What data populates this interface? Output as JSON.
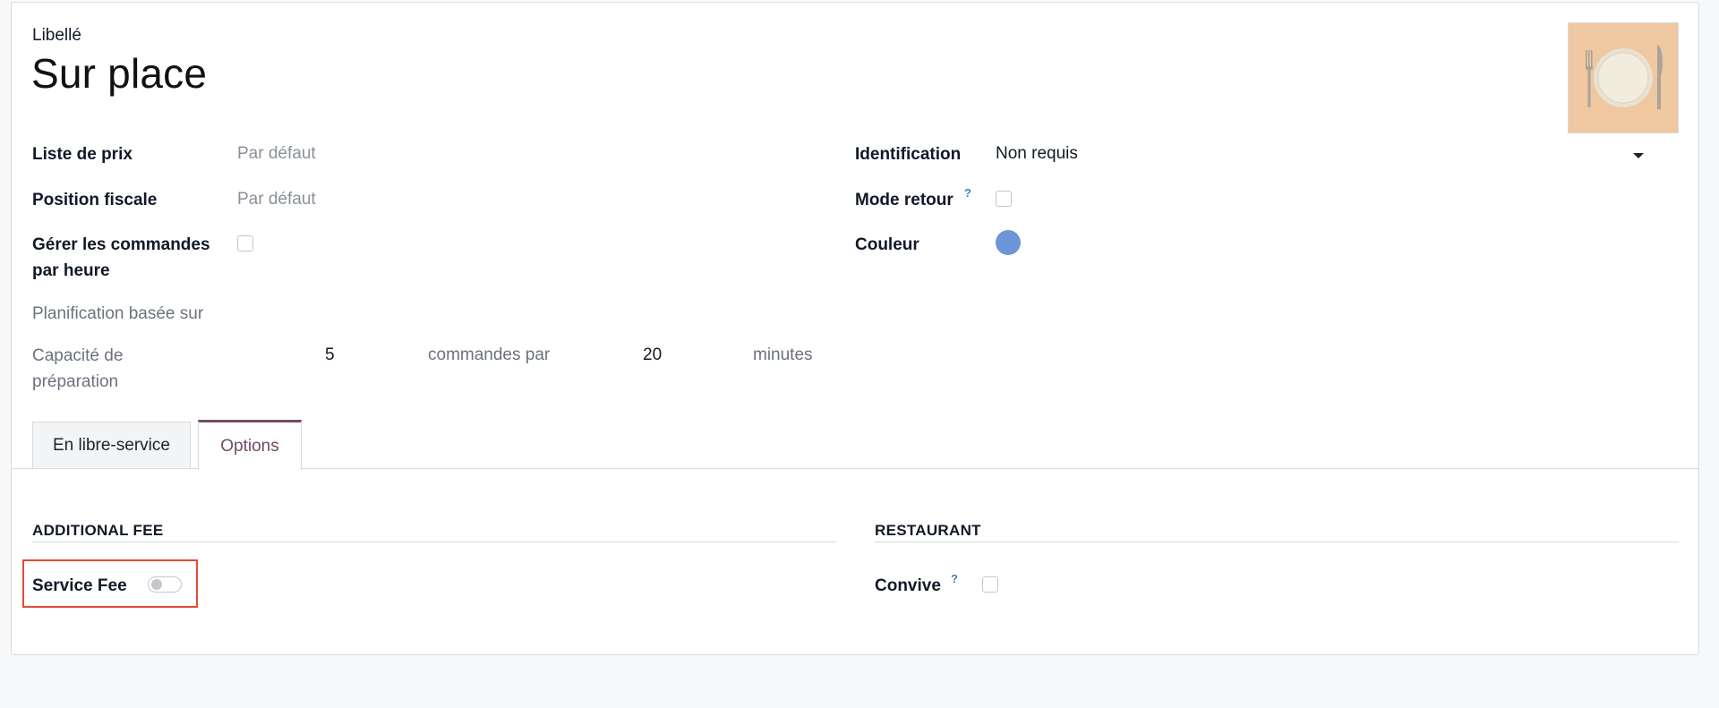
{
  "header": {
    "label": "Libellé",
    "title": "Sur place",
    "image_icon": "plate-cutlery-icon"
  },
  "left_fields": {
    "pricelist": {
      "label": "Liste de prix",
      "placeholder": "Par défaut"
    },
    "fiscal_position": {
      "label": "Position fiscale",
      "placeholder": "Par défaut"
    },
    "manage_orders": {
      "label_line1": "Gérer les commandes",
      "label_line2": "par heure"
    },
    "scheduling": {
      "label": "Planification basée sur"
    },
    "capacity": {
      "label_line1": "Capacité de",
      "label_line2": "préparation",
      "orders_value": "5",
      "orders_text": "commandes par",
      "minutes_value": "20",
      "minutes_text": "minutes"
    }
  },
  "right_fields": {
    "identification": {
      "label": "Identification",
      "value": "Non requis"
    },
    "return_mode": {
      "label": "Mode retour",
      "help": "?"
    },
    "color": {
      "label": "Couleur",
      "value": "#6c96d8"
    }
  },
  "tabs": [
    {
      "label": "En libre-service",
      "active": false
    },
    {
      "label": "Options",
      "active": true
    }
  ],
  "options": {
    "additional_fee": {
      "title": "ADDITIONAL FEE",
      "service_fee_label": "Service Fee",
      "service_fee_on": false
    },
    "restaurant": {
      "title": "RESTAURANT",
      "convive_label": "Convive",
      "help": "?"
    }
  },
  "colors": {
    "accent": "#714b67",
    "highlight": "#e34a34",
    "swatch": "#6c96d8"
  }
}
